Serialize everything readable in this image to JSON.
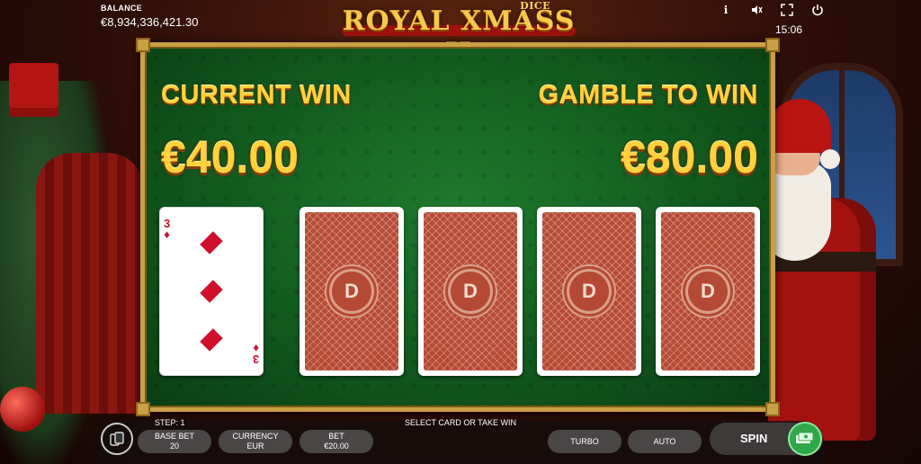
{
  "header": {
    "balance_label": "BALANCE",
    "balance_value": "€8,934,336,421.30",
    "logo_text": "ROYAL XMASS II",
    "logo_dice": "DICE",
    "time": "15:06",
    "icons": [
      "info-icon",
      "sound-icon",
      "fullscreen-icon",
      "power-icon"
    ]
  },
  "gamble": {
    "current_win_label": "CURRENT WIN",
    "current_win_amount": "€40.00",
    "gamble_to_win_label": "GAMBLE TO WIN",
    "gamble_to_win_amount": "€80.00",
    "dealer_card": {
      "rank": "3",
      "suit": "diamonds",
      "suit_symbol": "♦"
    },
    "face_down_cards": 4
  },
  "footer": {
    "step": "STEP: 1",
    "hint": "SELECT CARD OR TAKE WIN",
    "base_bet_label": "BASE BET",
    "base_bet_value": "20",
    "currency_label": "CURRENCY",
    "currency_value": "EUR",
    "bet_label": "BET",
    "bet_value": "€20.00",
    "turbo_label": "TURBO",
    "auto_label": "AUTO",
    "spin_label": "SPIN"
  },
  "colors": {
    "gold": "#ffd23c",
    "felt": "#125a1f",
    "card_back": "#b44a35",
    "spin_green": "#2fa84a"
  }
}
